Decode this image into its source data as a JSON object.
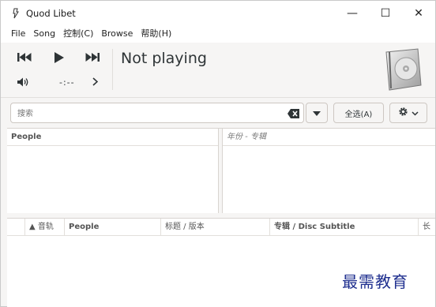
{
  "window": {
    "title": "Quod Libet",
    "controls": {
      "minimize": "—",
      "maximize": "☐",
      "close": "✕"
    }
  },
  "menubar": {
    "items": [
      {
        "label": "File"
      },
      {
        "label": "Song"
      },
      {
        "label": "控制(C)"
      },
      {
        "label": "Browse"
      },
      {
        "label": "帮助(H)"
      }
    ]
  },
  "player": {
    "status": "Not playing",
    "time": "-:--",
    "icons": {
      "previous": "previous-track-icon",
      "play": "play-icon",
      "next": "next-track-icon",
      "volume": "volume-icon",
      "seek": "chevron-right-icon",
      "cover": "album-cover-icon"
    }
  },
  "search": {
    "placeholder": "搜索",
    "value": "",
    "select_all_label": "全选(A)"
  },
  "browser": {
    "left_pane_header": "People",
    "right_pane_header": "年份 - 专辑"
  },
  "songlist": {
    "columns": [
      {
        "label": "▲ 音轨"
      },
      {
        "label": "People"
      },
      {
        "label": "标题 / 版本"
      },
      {
        "label": "专辑 / Disc Subtitle"
      },
      {
        "label": "长"
      }
    ]
  },
  "watermark": "最需教育",
  "colors": {
    "background": "#f6f5f4",
    "text": "#2e3436",
    "border": "#cdc7c2",
    "watermark": "#1f2f8f"
  }
}
